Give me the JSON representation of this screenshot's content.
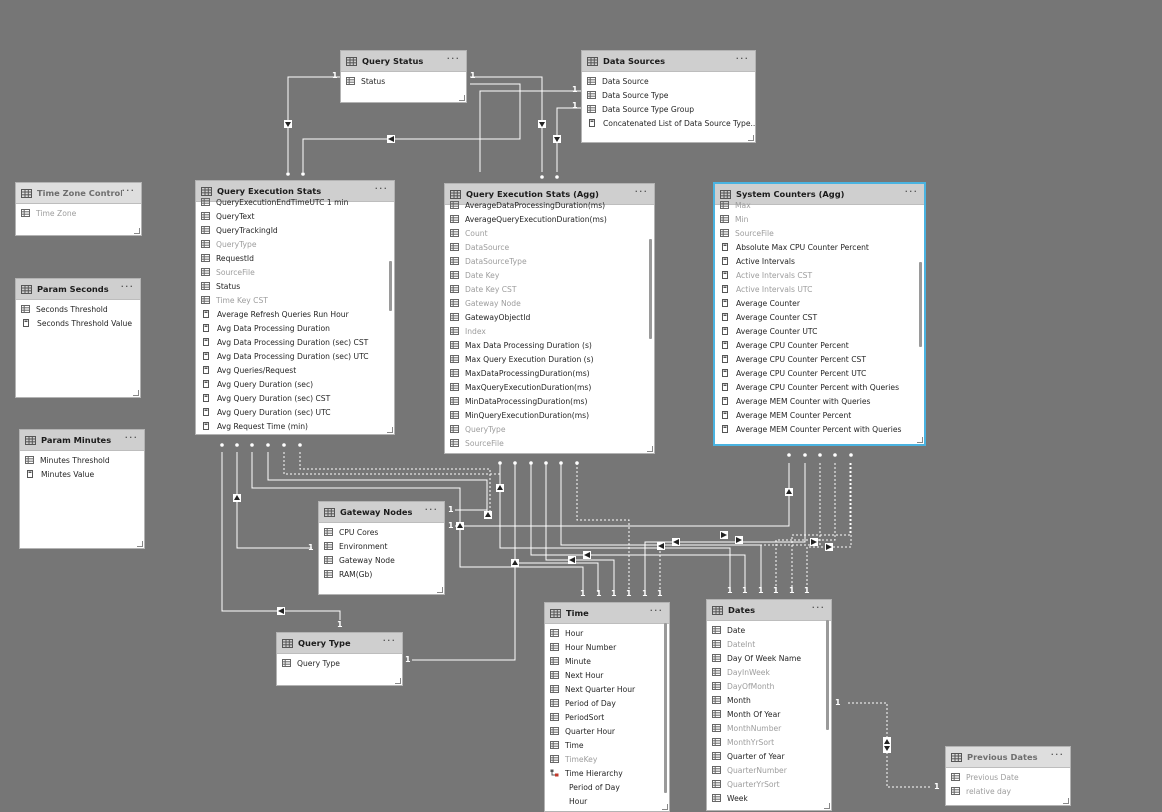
{
  "tables": [
    {
      "id": "query-status",
      "title": "Query Status",
      "fields": [
        {
          "label": "Status",
          "icon": "table"
        }
      ]
    },
    {
      "id": "data-sources",
      "title": "Data Sources",
      "fields": [
        {
          "label": "Data Source",
          "icon": "table"
        },
        {
          "label": "Data Source Type",
          "icon": "table"
        },
        {
          "label": "Data Source Type Group",
          "icon": "table"
        },
        {
          "label": "Concatenated List of Data Source Type...",
          "icon": "calc"
        }
      ]
    },
    {
      "id": "time-zone-control",
      "title": "Time Zone Control",
      "fields": [
        {
          "label": "Time Zone",
          "icon": "table",
          "hidden": true
        }
      ]
    },
    {
      "id": "param-seconds",
      "title": "Param Seconds",
      "fields": [
        {
          "label": "Seconds Threshold",
          "icon": "table"
        },
        {
          "label": "Seconds Threshold Value",
          "icon": "calc"
        }
      ]
    },
    {
      "id": "param-minutes",
      "title": "Param Minutes",
      "fields": [
        {
          "label": "Minutes Threshold",
          "icon": "table"
        },
        {
          "label": "Minutes Value",
          "icon": "calc"
        }
      ]
    },
    {
      "id": "query-execution-stats",
      "title": "Query Execution Stats",
      "fields": [
        {
          "label": "QueryExecutionEndTimeUTC 1 min",
          "icon": "table"
        },
        {
          "label": "QueryText",
          "icon": "table"
        },
        {
          "label": "QueryTrackingId",
          "icon": "table"
        },
        {
          "label": "QueryType",
          "icon": "table",
          "hidden": true
        },
        {
          "label": "RequestId",
          "icon": "table"
        },
        {
          "label": "SourceFile",
          "icon": "table",
          "hidden": true
        },
        {
          "label": "Status",
          "icon": "table"
        },
        {
          "label": "Time Key CST",
          "icon": "table",
          "hidden": true
        },
        {
          "label": "Average Refresh Queries Run Hour",
          "icon": "calc"
        },
        {
          "label": "Avg Data Processing Duration",
          "icon": "calc"
        },
        {
          "label": "Avg Data Processing Duration (sec) CST",
          "icon": "calc"
        },
        {
          "label": "Avg Data Processing Duration (sec) UTC",
          "icon": "calc"
        },
        {
          "label": "Avg Queries/Request",
          "icon": "calc"
        },
        {
          "label": "Avg Query Duration (sec)",
          "icon": "calc"
        },
        {
          "label": "Avg Query Duration (sec) CST",
          "icon": "calc"
        },
        {
          "label": "Avg Query Duration (sec) UTC",
          "icon": "calc"
        },
        {
          "label": "Avg Request Time (min)",
          "icon": "calc"
        }
      ]
    },
    {
      "id": "query-execution-stats-agg",
      "title": "Query Execution Stats (Agg)",
      "fields": [
        {
          "label": "AverageDataProcessingDuration(ms)",
          "icon": "table"
        },
        {
          "label": "AverageQueryExecutionDuration(ms)",
          "icon": "table"
        },
        {
          "label": "Count",
          "icon": "table",
          "hidden": true
        },
        {
          "label": "DataSource",
          "icon": "table",
          "hidden": true
        },
        {
          "label": "DataSourceType",
          "icon": "table",
          "hidden": true
        },
        {
          "label": "Date Key",
          "icon": "table",
          "hidden": true
        },
        {
          "label": "Date Key CST",
          "icon": "table",
          "hidden": true
        },
        {
          "label": "Gateway Node",
          "icon": "table",
          "hidden": true
        },
        {
          "label": "GatewayObjectId",
          "icon": "table"
        },
        {
          "label": "Index",
          "icon": "table",
          "hidden": true
        },
        {
          "label": "Max Data Processing Duration (s)",
          "icon": "table"
        },
        {
          "label": "Max Query Execution Duration (s)",
          "icon": "table"
        },
        {
          "label": "MaxDataProcessingDuration(ms)",
          "icon": "table"
        },
        {
          "label": "MaxQueryExecutionDuration(ms)",
          "icon": "table"
        },
        {
          "label": "MinDataProcessingDuration(ms)",
          "icon": "table"
        },
        {
          "label": "MinQueryExecutionDuration(ms)",
          "icon": "table"
        },
        {
          "label": "QueryType",
          "icon": "table",
          "hidden": true
        },
        {
          "label": "SourceFile",
          "icon": "table",
          "hidden": true
        }
      ]
    },
    {
      "id": "system-counters-agg",
      "title": "System Counters (Agg)",
      "fields": [
        {
          "label": "Max",
          "icon": "table",
          "hidden": true
        },
        {
          "label": "Min",
          "icon": "table",
          "hidden": true
        },
        {
          "label": "SourceFile",
          "icon": "table",
          "hidden": true
        },
        {
          "label": "Absolute Max CPU Counter Percent",
          "icon": "calc"
        },
        {
          "label": "Active Intervals",
          "icon": "calc"
        },
        {
          "label": "Active Intervals CST",
          "icon": "calc",
          "hidden": true
        },
        {
          "label": "Active Intervals UTC",
          "icon": "calc",
          "hidden": true
        },
        {
          "label": "Average Counter",
          "icon": "calc"
        },
        {
          "label": "Average Counter CST",
          "icon": "calc"
        },
        {
          "label": "Average Counter UTC",
          "icon": "calc"
        },
        {
          "label": "Average CPU Counter Percent",
          "icon": "calc"
        },
        {
          "label": "Average CPU Counter Percent CST",
          "icon": "calc"
        },
        {
          "label": "Average CPU Counter Percent UTC",
          "icon": "calc"
        },
        {
          "label": "Average CPU Counter Percent with Queries",
          "icon": "calc"
        },
        {
          "label": "Average MEM Counter with Queries",
          "icon": "calc"
        },
        {
          "label": "Average MEM Counter Percent",
          "icon": "calc"
        },
        {
          "label": "Average MEM Counter Percent with Queries",
          "icon": "calc"
        }
      ]
    },
    {
      "id": "gateway-nodes",
      "title": "Gateway Nodes",
      "fields": [
        {
          "label": "CPU Cores",
          "icon": "table"
        },
        {
          "label": "Environment",
          "icon": "table"
        },
        {
          "label": "Gateway Node",
          "icon": "table"
        },
        {
          "label": "RAM(Gb)",
          "icon": "table"
        }
      ]
    },
    {
      "id": "query-type",
      "title": "Query Type",
      "fields": [
        {
          "label": "Query Type",
          "icon": "table"
        }
      ]
    },
    {
      "id": "time",
      "title": "Time",
      "fields": [
        {
          "label": "Hour",
          "icon": "table"
        },
        {
          "label": "Hour Number",
          "icon": "table"
        },
        {
          "label": "Minute",
          "icon": "table"
        },
        {
          "label": "Next Hour",
          "icon": "table"
        },
        {
          "label": "Next Quarter Hour",
          "icon": "table"
        },
        {
          "label": "Period of Day",
          "icon": "table"
        },
        {
          "label": "PeriodSort",
          "icon": "table"
        },
        {
          "label": "Quarter Hour",
          "icon": "table"
        },
        {
          "label": "Time",
          "icon": "table"
        },
        {
          "label": "TimeKey",
          "icon": "table",
          "hidden": true
        },
        {
          "label": "Time Hierarchy",
          "icon": "hierarchy"
        },
        {
          "label": "Period of Day",
          "icon": "none",
          "sub": true
        },
        {
          "label": "Hour",
          "icon": "none",
          "sub": true
        }
      ]
    },
    {
      "id": "dates",
      "title": "Dates",
      "fields": [
        {
          "label": "Date",
          "icon": "table"
        },
        {
          "label": "DateInt",
          "icon": "table",
          "hidden": true
        },
        {
          "label": "Day Of Week Name",
          "icon": "table"
        },
        {
          "label": "DayInWeek",
          "icon": "table",
          "hidden": true
        },
        {
          "label": "DayOfMonth",
          "icon": "table",
          "hidden": true
        },
        {
          "label": "Month",
          "icon": "table"
        },
        {
          "label": "Month Of Year",
          "icon": "table"
        },
        {
          "label": "MonthNumber",
          "icon": "table",
          "hidden": true
        },
        {
          "label": "MonthYrSort",
          "icon": "table",
          "hidden": true
        },
        {
          "label": "Quarter of Year",
          "icon": "table"
        },
        {
          "label": "QuarterNumber",
          "icon": "table",
          "hidden": true
        },
        {
          "label": "QuarterYrSort",
          "icon": "table",
          "hidden": true
        },
        {
          "label": "Week",
          "icon": "table"
        }
      ]
    },
    {
      "id": "previous-dates",
      "title": "Previous Dates",
      "fields": [
        {
          "label": "Previous Date",
          "icon": "table",
          "hidden": true
        },
        {
          "label": "relative day",
          "icon": "table",
          "hidden": true
        }
      ]
    }
  ],
  "relationships": {
    "one_label": "1"
  },
  "colors": {
    "canvas": "#767676",
    "header": "#cfcfcf",
    "selected_border": "#4ab3e0",
    "hidden_text": "#9d9d9d",
    "line": "#ffffff"
  }
}
